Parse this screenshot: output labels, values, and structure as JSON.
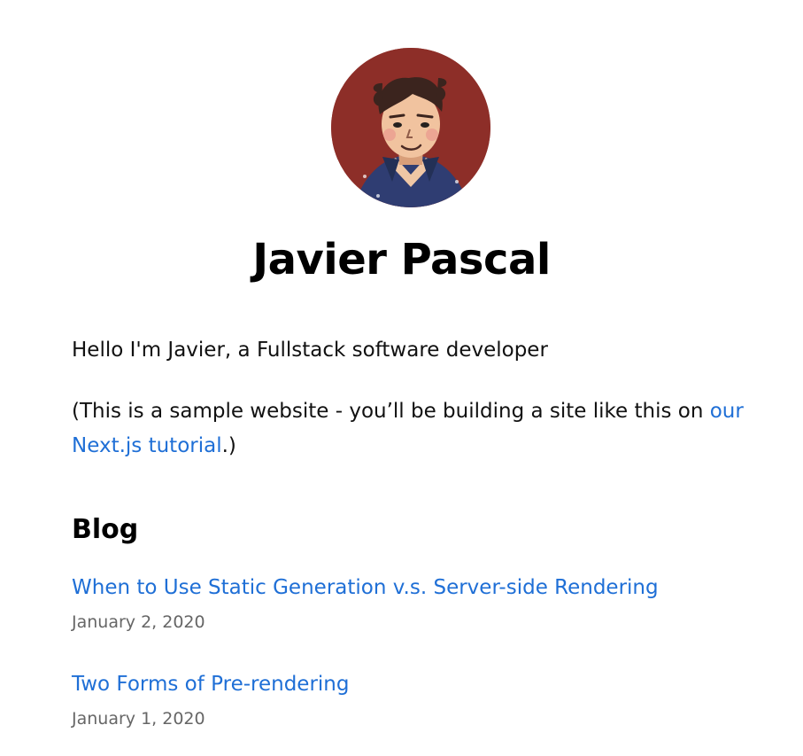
{
  "profile": {
    "name": "Javier Pascal",
    "avatar_icon": "avatar-illustration-icon",
    "intro": "Hello I'm Javier, a Fullstack software developer",
    "note_prefix": "(This is a sample website - you’ll be building a site like this on ",
    "tutorial_link": "our Next.js tutorial",
    "note_suffix": ".)"
  },
  "blog": {
    "title": "Blog",
    "posts": [
      {
        "title": "When to Use Static Generation v.s. Server-side Rendering",
        "date": "January 2, 2020"
      },
      {
        "title": "Two Forms of Pre-rendering",
        "date": "January 1, 2020"
      }
    ]
  },
  "colors": {
    "link": "#1f6fd6",
    "avatar_background": "#8d2e28",
    "date_text": "#666666"
  }
}
